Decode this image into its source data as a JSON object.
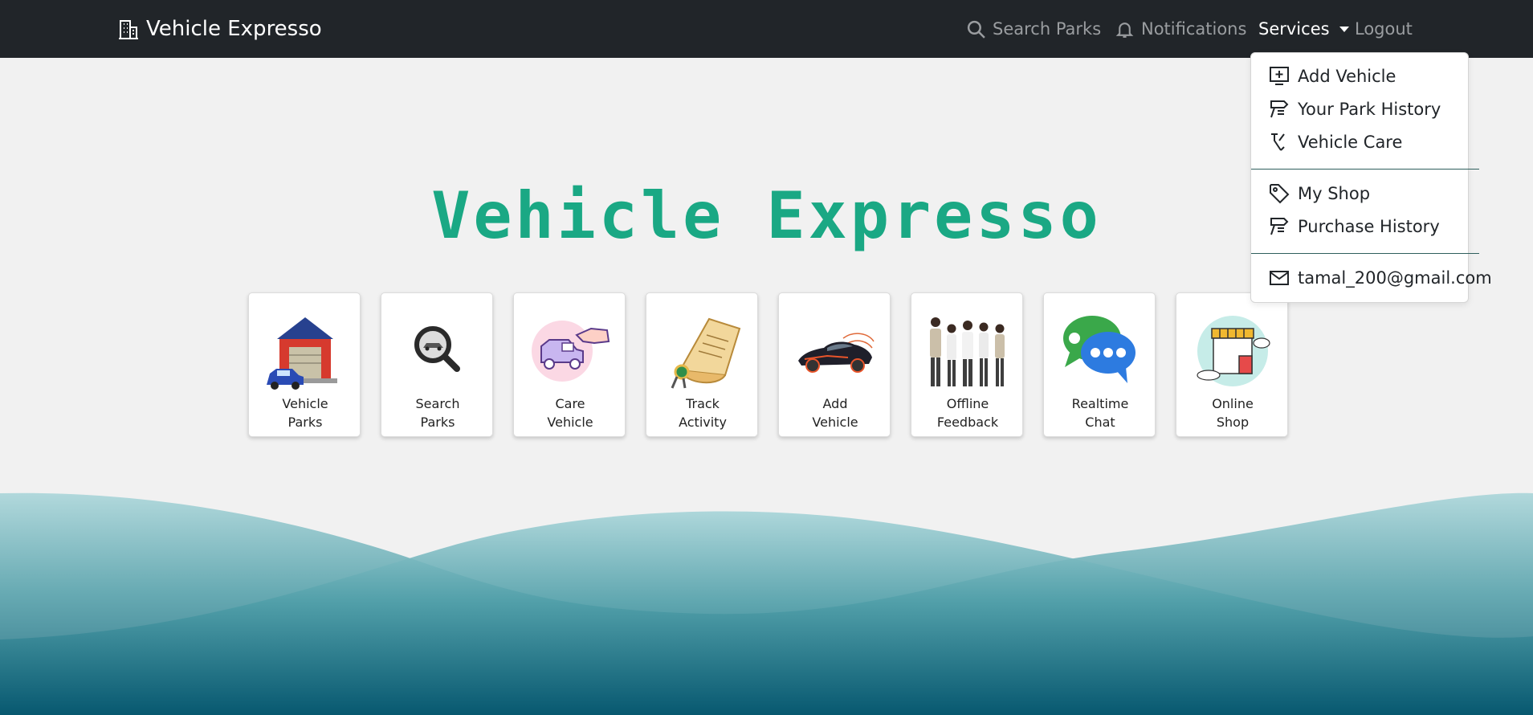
{
  "navbar": {
    "brand": "Vehicle Expresso",
    "links": {
      "search": "Search Parks",
      "notifications": "Notifications",
      "services": "Services",
      "logout": "Logout"
    }
  },
  "hero": {
    "title": "Vehicle Expresso"
  },
  "cards": [
    {
      "line1": "Vehicle",
      "line2": "Parks",
      "icon": "garage-icon"
    },
    {
      "line1": "Search",
      "line2": "Parks",
      "icon": "magnifier-icon"
    },
    {
      "line1": "Care",
      "line2": "Vehicle",
      "icon": "car-care-icon"
    },
    {
      "line1": "Track",
      "line2": "Activity",
      "icon": "scroll-icon"
    },
    {
      "line1": "Add",
      "line2": "Vehicle",
      "icon": "sports-car-icon"
    },
    {
      "line1": "Offline",
      "line2": "Feedback",
      "icon": "team-photo-icon"
    },
    {
      "line1": "Realtime",
      "line2": "Chat",
      "icon": "chat-bubbles-icon"
    },
    {
      "line1": "Online",
      "line2": "Shop",
      "icon": "shop-icon"
    }
  ],
  "dropdown": {
    "items": [
      {
        "label": "Add Vehicle",
        "icon": "plus-square-icon"
      },
      {
        "label": "Your Park History",
        "icon": "signpost-icon"
      },
      {
        "label": "Vehicle Care",
        "icon": "tools-icon"
      },
      {
        "label": "My Shop",
        "icon": "tag-icon"
      },
      {
        "label": "Purchase History",
        "icon": "signpost-icon"
      },
      {
        "label": "tamal_200@gmail.com",
        "icon": "envelope-icon"
      }
    ]
  },
  "colors": {
    "navbar": "#212529",
    "accent": "#1aa884",
    "background": "#f1f1f1",
    "wave_light": "#a6d4d8",
    "wave_dark": "#04566e"
  }
}
